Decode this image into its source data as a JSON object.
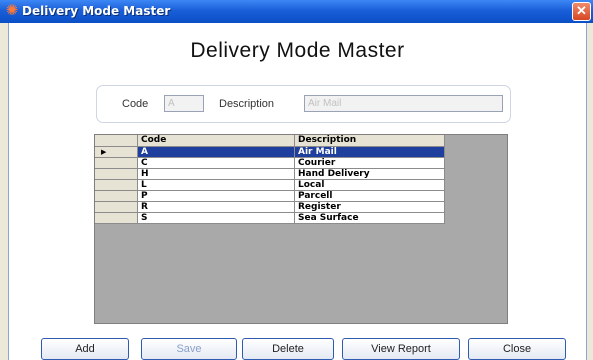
{
  "window": {
    "title": "Delivery Mode Master",
    "close_glyph": "✕"
  },
  "heading": "Delivery Mode Master",
  "filter": {
    "code_label": "Code",
    "code_value": "A",
    "description_label": "Description",
    "description_value": "Air Mail"
  },
  "grid": {
    "columns": [
      "Code",
      "Description"
    ],
    "selected_row_index": 0,
    "row_indicator_glyph": "▶",
    "rows": [
      {
        "code": "A",
        "description": "Air Mail"
      },
      {
        "code": "C",
        "description": "Courier"
      },
      {
        "code": "H",
        "description": "Hand Delivery"
      },
      {
        "code": "L",
        "description": "Local"
      },
      {
        "code": "P",
        "description": "Parcell"
      },
      {
        "code": "R",
        "description": "Register"
      },
      {
        "code": "S",
        "description": "Sea Surface"
      }
    ]
  },
  "buttons": {
    "add": "Add",
    "save": "Save",
    "delete": "Delete",
    "view_report": "View Report",
    "close": "Close"
  },
  "colors": {
    "titlebar": "#1a5fd8",
    "selection": "#1f3f9e",
    "grid_background": "#a9a9a9"
  },
  "icons": {
    "app": "spinner-icon",
    "close": "close-icon",
    "row_indicator": "row-pointer-icon"
  }
}
